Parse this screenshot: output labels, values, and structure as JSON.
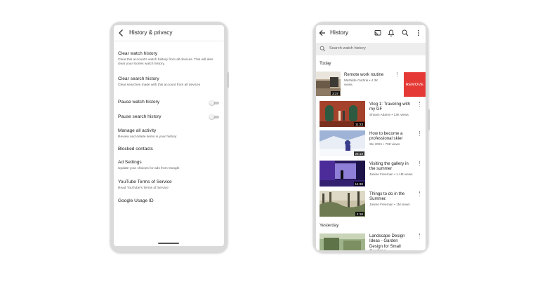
{
  "left": {
    "title": "History & privacy",
    "items": [
      {
        "title": "Clear watch history",
        "subtitle": "Clear this account's watch history from all devices. This will also clear your stories watch history."
      },
      {
        "title": "Clear search history",
        "subtitle": "Clear searches made with this account from all devices"
      },
      {
        "title": "Pause watch history",
        "toggle": false
      },
      {
        "title": "Pause search history",
        "toggle": false
      },
      {
        "title": "Manage all activity",
        "subtitle": "Review and delete items in your history"
      },
      {
        "title": "Blocked contacts"
      },
      {
        "title": "Ad Settings",
        "subtitle": "Update your choices for ads from Google"
      },
      {
        "title": "YouTube Terms of Service",
        "subtitle": "Read YouTube's Terms of Service"
      },
      {
        "title": "Google Usage ID"
      }
    ]
  },
  "right": {
    "title": "History",
    "search_placeholder": "Search watch history",
    "sections": {
      "today": "Today",
      "yesterday": "Yesterday"
    },
    "remove_label": "REMOVE",
    "videos": [
      {
        "title": "Remote work routine",
        "meta": "Mathilde Guthrie • 4.3K views",
        "duration": "3:37"
      },
      {
        "title": "Vlog 1: Traveling with my GF",
        "meta": "Shyam Adams • 13K views",
        "duration": "11:23"
      },
      {
        "title": "How to become a professional skier",
        "meta": "Ski 2021 • 798 views",
        "duration": "28:19"
      },
      {
        "title": "Visiting the gallery in the summer",
        "meta": "Janine Freeman • 1.1M views",
        "duration": "14:30"
      },
      {
        "title": "Things to do in the Summer.",
        "meta": "Janine Freeman • 1M views",
        "duration": "4:18"
      },
      {
        "title": "Landscape Design Ideas - Garden Design for Small Gardens",
        "meta": ""
      }
    ]
  },
  "colors": {
    "accent_remove": "#e53935",
    "background": "#ffffff",
    "frame": "#dadada"
  },
  "icons": [
    "back-arrow-icon",
    "cast-icon",
    "bell-icon",
    "search-icon",
    "more-vert-icon"
  ]
}
